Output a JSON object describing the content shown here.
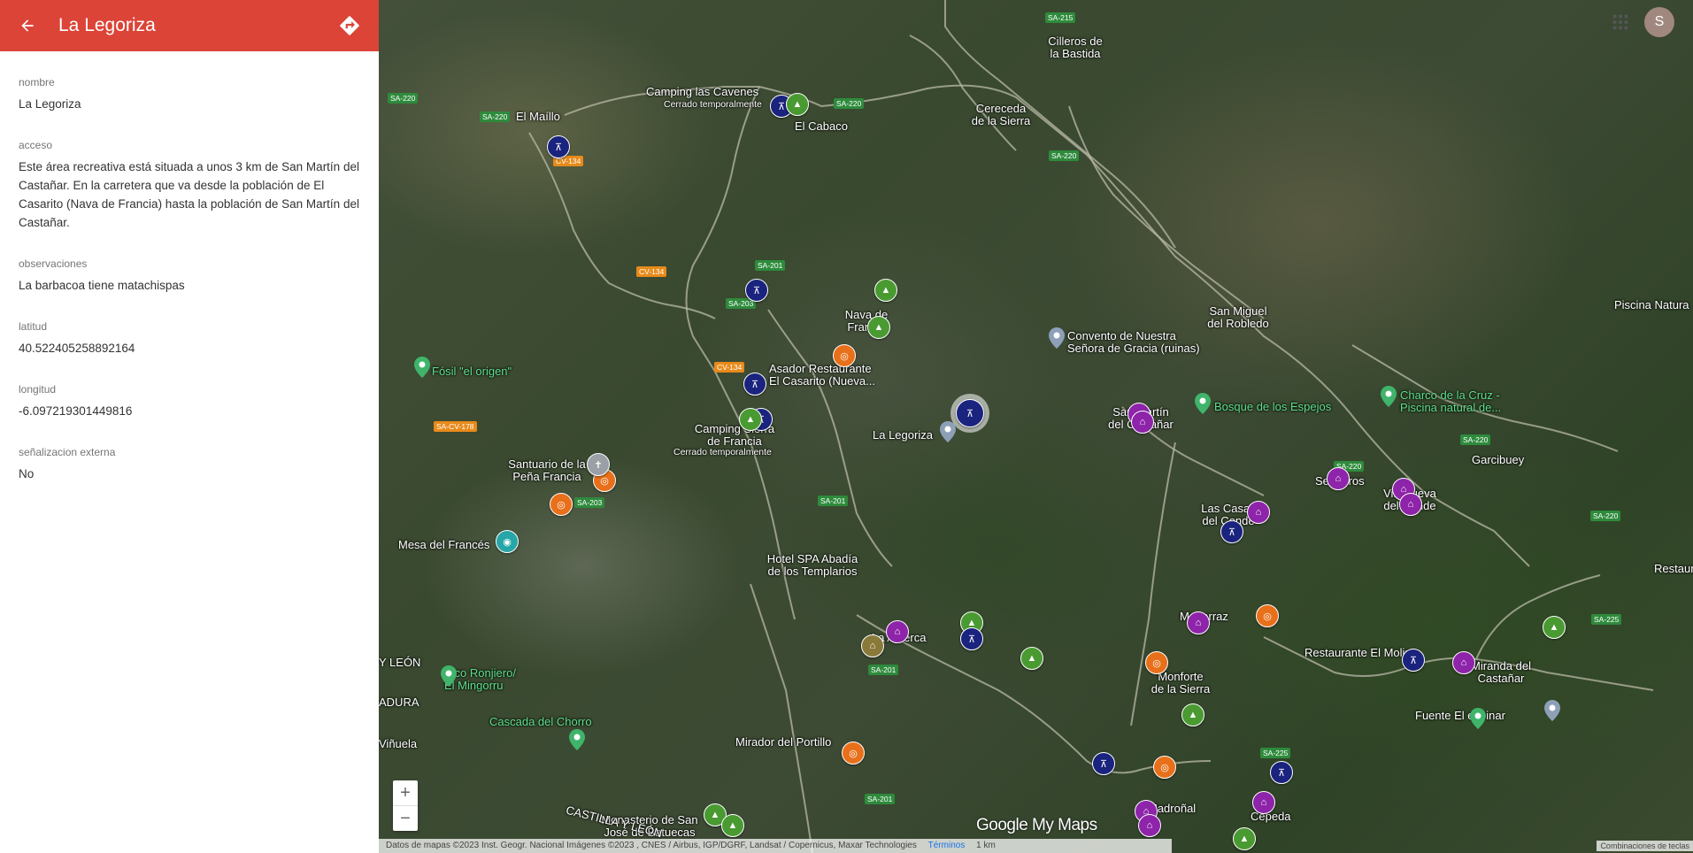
{
  "panel": {
    "title": "La Legoriza",
    "fields": [
      {
        "label": "nombre",
        "value": "La Legoriza"
      },
      {
        "label": "acceso",
        "value": "Este área recreativa está situada a unos 3 km de San Martín del Castañar. En la carretera que va desde la población de El Casarito (Nava de Francia) hasta la población de San Martín del Castañar."
      },
      {
        "label": "observaciones",
        "value": "La barbacoa tiene matachispas"
      },
      {
        "label": "latitud",
        "value": "40.522405258892164"
      },
      {
        "label": "longitud",
        "value": "-6.097219301449816"
      },
      {
        "label": "señalizacion externa",
        "value": "No"
      }
    ]
  },
  "map": {
    "places": {
      "cilleros": "Cilleros de\nla Bastida",
      "camping_cavenes": "Camping las Cavenes",
      "camping_cavenes_status": "Cerrado temporalmente",
      "el_maillo": "El Maíllo",
      "el_cabaco": "El Cabaco",
      "cereceda": "Cereceda\nde la Sierra",
      "nava": "Nava de\nFrancia",
      "asador": "Asador Restaurante\nEl Casarito (Nueva...",
      "fosil": "Fósil \"el origen\"",
      "convento": "Convento de Nuestra\nSeñora de Gracia (ruinas)",
      "san_miguel": "San Miguel\ndel Robledo",
      "piscina_natural": "Piscina Natura",
      "charco": "Charco de la Cruz -\nPiscina natural de...",
      "bosque": "Bosque de los Espejos",
      "san_martin": "San Martín\ndel Castañar",
      "la_legoriza": "La Legoriza",
      "camping_sierra": "Camping Sierra\nde Francia",
      "camping_sierra_status": "Cerrado temporalmente",
      "santuario": "Santuario de la\nPeña Francia",
      "sequeros": "Sequeros",
      "villanueva": "Villanueva\ndel Conde",
      "garcibuey": "Garcibuey",
      "las_casas": "Las Casas\ndel Conde",
      "mesa": "Mesa del Francés",
      "hotel": "Hotel SPA Abadía\nde los Templarios",
      "restaurante_edge": "Restaurant",
      "mogarraz": "Mogarraz",
      "la_alberca": "La Alberca",
      "monforte": "Monforte\nde la Sierra",
      "restaurante_molino": "Restaurante El Molino",
      "miranda": "Miranda del\nCastañar",
      "y_leon": "Y LEÓN",
      "pico": "Pico Ronjiero/\nEl Mingorru",
      "adura": "ADURA",
      "cascada": "Cascada del Chorro",
      "fuente": "Fuente El espinar",
      "vinuela": "Viñuela",
      "mirador": "Mirador del Portillo",
      "monasterio": "Monasterio de San\nJosé de Batuecas",
      "castilla": "CASTILLA Y LEÓN",
      "madronal": "Madroñal",
      "cepeda": "Cepeda"
    },
    "roads": [
      "SA-215",
      "SA-220",
      "SA-220",
      "SA-220",
      "CV-134",
      "SA-220",
      "SA-201",
      "SA-203",
      "CV-134",
      "CV-134",
      "SA-CV-178",
      "SA-203",
      "SA-201",
      "SA-220",
      "SA-220",
      "SA-220",
      "SA-201",
      "SA-225",
      "SA-225",
      "SA-201"
    ],
    "zoom_in": "+",
    "zoom_out": "−",
    "logo": "Google My Maps",
    "attribution": "Datos de mapas ©2023 Inst. Geogr. Nacional Imágenes ©2023 , CNES / Airbus, IGP/DGRF, Landsat / Copernicus, Maxar Technologies",
    "terms": "Términos",
    "scale": "1 km",
    "shortcuts": "Combinaciones de teclas",
    "avatar_letter": "S"
  },
  "colors": {
    "header": "#db4437",
    "picnic": "#1a237e",
    "tree": "#4a9a32",
    "viewpoint": "#e8701a",
    "house": "#8e24aa"
  }
}
